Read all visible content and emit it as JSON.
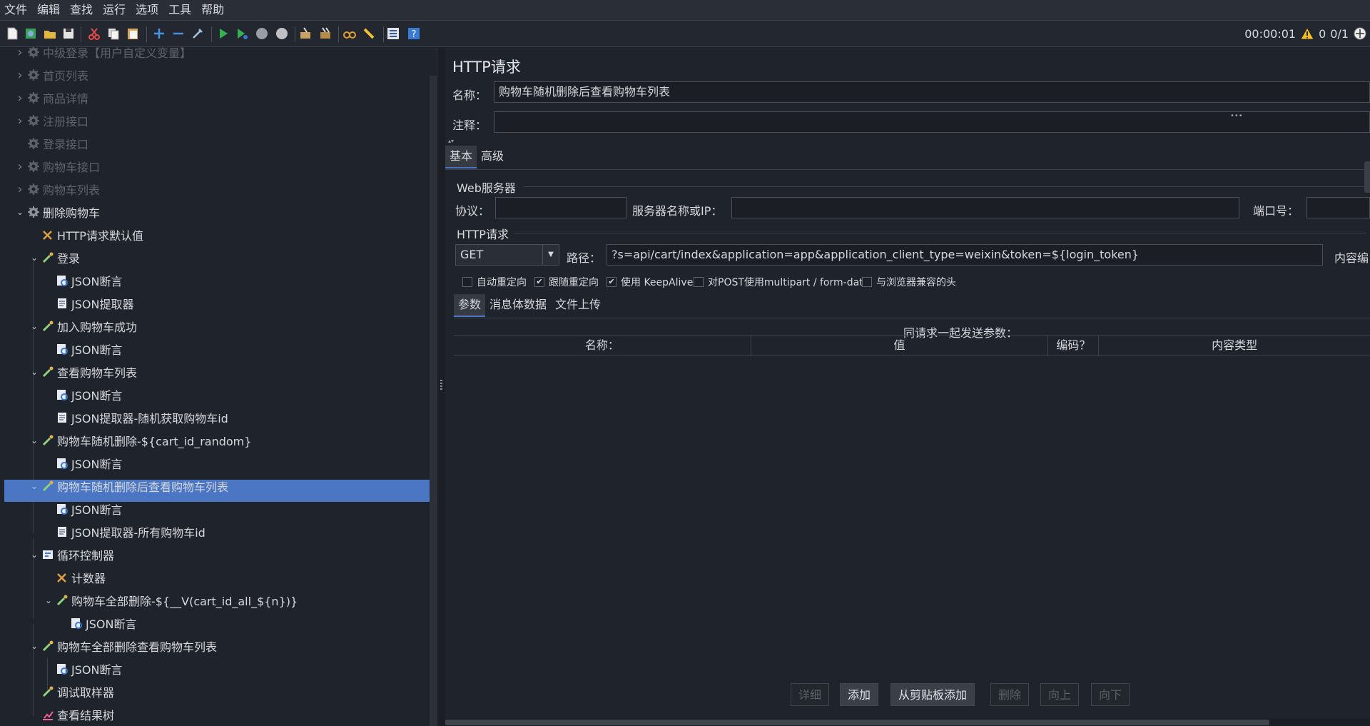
{
  "menu": [
    "文件",
    "编辑",
    "查找",
    "运行",
    "选项",
    "工具",
    "帮助"
  ],
  "toolbar": {
    "icons": [
      "new-icon",
      "templates-icon",
      "open-icon",
      "save-icon",
      "cut-icon",
      "copy-icon",
      "paste-icon",
      "expand-icon",
      "collapse-icon",
      "toggle-icon",
      "start-icon",
      "start-no-pause-icon",
      "stop-icon",
      "shutdown-icon",
      "clear-icon",
      "clear-all-icon",
      "search-icon",
      "reset-search-icon",
      "function-helper-icon",
      "help-icon"
    ]
  },
  "status": {
    "timer": "00:00:01",
    "warnings": "0",
    "threads": "0/1"
  },
  "tree": [
    {
      "label": "中级登录【用户自定义变量】",
      "dim": true
    },
    {
      "label": "首页列表",
      "dim": true
    },
    {
      "label": "商品详情",
      "dim": true
    },
    {
      "label": "注册接口",
      "dim": true
    },
    {
      "label": "登录接口",
      "dim": true
    },
    {
      "label": "购物车接口",
      "dim": true
    },
    {
      "label": "购物车列表",
      "dim": true
    },
    {
      "label": "删除购物车"
    },
    {
      "label": "HTTP请求默认值"
    },
    {
      "label": "登录"
    },
    {
      "label": "JSON断言"
    },
    {
      "label": "JSON提取器"
    },
    {
      "label": "加入购物车成功"
    },
    {
      "label": "JSON断言"
    },
    {
      "label": "查看购物车列表"
    },
    {
      "label": "JSON断言"
    },
    {
      "label": "JSON提取器-随机获取购物车id"
    },
    {
      "label": "购物车随机删除-${cart_id_random}"
    },
    {
      "label": "JSON断言"
    },
    {
      "label": "购物车随机删除后查看购物车列表"
    },
    {
      "label": "JSON断言"
    },
    {
      "label": "JSON提取器-所有购物车id"
    },
    {
      "label": "循环控制器"
    },
    {
      "label": "计数器"
    },
    {
      "label": "购物车全部删除-${__V(cart_id_all_${n})}"
    },
    {
      "label": "JSON断言"
    },
    {
      "label": "购物车全部删除查看购物车列表"
    },
    {
      "label": "JSON断言"
    },
    {
      "label": "调试取样器"
    },
    {
      "label": "查看结果树"
    }
  ],
  "panel": {
    "title": "HTTP请求",
    "name_label": "名称：",
    "name_value": "购物车随机删除后查看购物车列表",
    "comment_label": "注释：",
    "comment_value": "",
    "tabs": [
      "基本",
      "高级"
    ],
    "web_server": "Web服务器",
    "protocol_label": "协议：",
    "server_label": "服务器名称或IP：",
    "port_label": "端口号：",
    "http_request": "HTTP请求",
    "method": "GET",
    "path_label": "路径：",
    "path_value": "?s=api/cart/index&application=app&application_client_type=weixin&token=${login_token}",
    "encoding_label": "内容编",
    "checkboxes": [
      {
        "label": "自动重定向",
        "checked": false
      },
      {
        "label": "跟随重定向",
        "checked": true
      },
      {
        "label": "使用 KeepAlive",
        "checked": true
      },
      {
        "label": "对POST使用multipart / form-data",
        "checked": false
      },
      {
        "label": "与浏览器兼容的头",
        "checked": false
      }
    ],
    "subtabs": [
      "参数",
      "消息体数据",
      "文件上传"
    ],
    "send_params": "同请求一起发送参数：",
    "columns": [
      "名称：",
      "值",
      "编码？",
      "内容类型"
    ],
    "buttons": [
      {
        "label": "详细",
        "enabled": false
      },
      {
        "label": "添加",
        "enabled": true
      },
      {
        "label": "从剪贴板添加",
        "enabled": true
      },
      {
        "label": "删除",
        "enabled": false
      },
      {
        "label": "向上",
        "enabled": false
      },
      {
        "label": "向下",
        "enabled": false
      }
    ]
  }
}
